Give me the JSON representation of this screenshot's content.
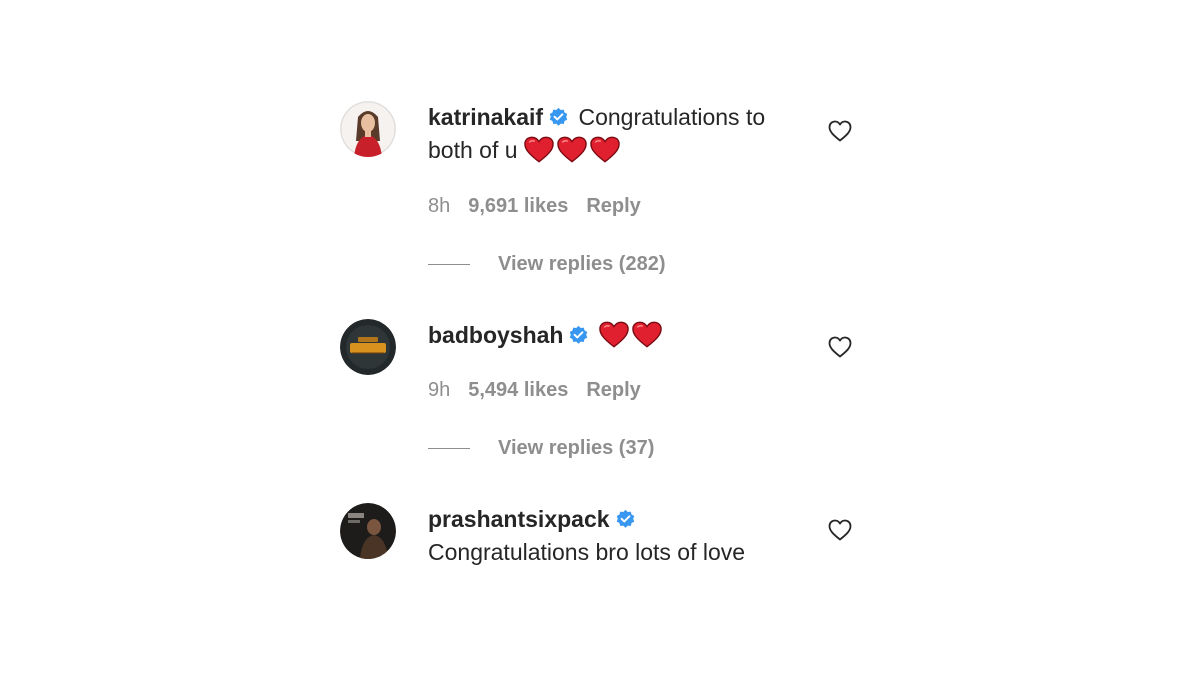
{
  "comments": [
    {
      "username": "katrinakaif",
      "verified": true,
      "text": "Congratulations to both of u",
      "emoji_hearts": 3,
      "time": "8h",
      "likes": "9,691 likes",
      "reply_label": "Reply",
      "view_replies": "View replies (282)",
      "avatar_icon": "profile-photo-woman-red-dress"
    },
    {
      "username": "badboyshah",
      "verified": true,
      "text": "",
      "emoji_hearts": 2,
      "time": "9h",
      "likes": "5,494 likes",
      "reply_label": "Reply",
      "view_replies": "View replies (37)",
      "avatar_icon": "profile-logo-dark-circle"
    },
    {
      "username": "prashantsixpack",
      "verified": true,
      "text": "Congratulations bro lots of love",
      "emoji_hearts": 0,
      "avatar_icon": "profile-photo-man-dark"
    }
  ],
  "colors": {
    "text": "#262626",
    "muted": "#8e8e8e",
    "verified": "#3897f0",
    "heart_emoji": "#e0202e"
  }
}
